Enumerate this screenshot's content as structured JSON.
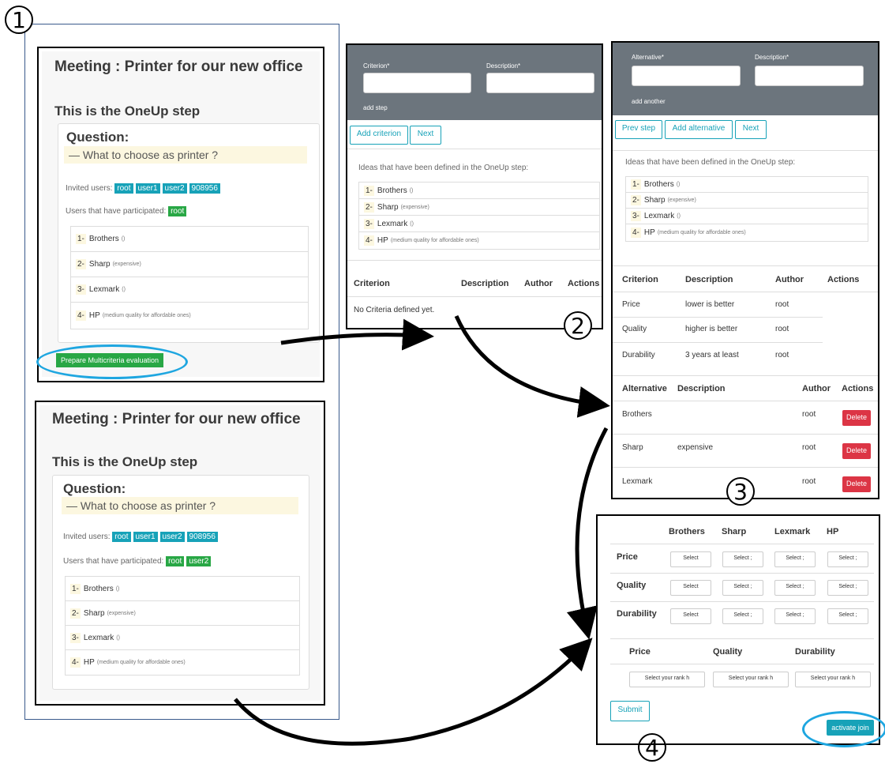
{
  "markers": [
    "1",
    "2",
    "3",
    "4"
  ],
  "panel1": {
    "meeting_title": "Meeting : Printer for our new office",
    "step_title": "This is the OneUp step",
    "question_label": "Question:",
    "question_text": "— What to choose as printer ?",
    "invited_label": "Invited users:",
    "invited_users": [
      "root",
      "user1",
      "user2",
      "908956"
    ],
    "participated_label": "Users that have participated:",
    "participated_users": [
      "root"
    ],
    "ideas": [
      {
        "num": "1-",
        "name": "Brothers",
        "note": "()"
      },
      {
        "num": "2-",
        "name": "Sharp",
        "note": "(expensive)"
      },
      {
        "num": "3-",
        "name": "Lexmark",
        "note": "()"
      },
      {
        "num": "4-",
        "name": "HP",
        "note": "(medium quality for affordable ones)"
      }
    ],
    "prepare_button": "Prepare Multicriteria evaluation"
  },
  "panel1b": {
    "meeting_title": "Meeting : Printer for our new office",
    "step_title": "This is the OneUp step",
    "question_label": "Question:",
    "question_text": "— What to choose as printer ?",
    "invited_label": "Invited users:",
    "invited_users": [
      "root",
      "user1",
      "user2",
      "908956"
    ],
    "participated_label": "Users that have participated:",
    "participated_users": [
      "root",
      "user2"
    ],
    "ideas": [
      {
        "num": "1-",
        "name": "Brothers",
        "note": "()"
      },
      {
        "num": "2-",
        "name": "Sharp",
        "note": "(expensive)"
      },
      {
        "num": "3-",
        "name": "Lexmark",
        "note": "()"
      },
      {
        "num": "4-",
        "name": "HP",
        "note": "(medium quality for affordable ones)"
      }
    ]
  },
  "panel2": {
    "criterion_label": "Criterion*",
    "description_label": "Description*",
    "add_step": "add step",
    "add_criterion_button": "Add criterion",
    "next_button": "Next",
    "ideas_heading": "Ideas that have been defined in the OneUp step:",
    "ideas": [
      {
        "num": "1-",
        "name": "Brothers",
        "note": "()"
      },
      {
        "num": "2-",
        "name": "Sharp",
        "note": "(expensive)"
      },
      {
        "num": "3-",
        "name": "Lexmark",
        "note": "()"
      },
      {
        "num": "4-",
        "name": "HP",
        "note": "(medium quality for affordable ones)"
      }
    ],
    "table_headers": [
      "Criterion",
      "Description",
      "Author",
      "Actions"
    ],
    "empty_text": "No Criteria defined yet."
  },
  "panel3": {
    "alternative_label": "Alternative*",
    "description_label": "Description*",
    "add_another": "add another",
    "prev_button": "Prev step",
    "add_alt_button": "Add alternative",
    "next_button": "Next",
    "ideas_heading": "Ideas that have been defined in the OneUp step:",
    "ideas": [
      {
        "num": "1-",
        "name": "Brothers",
        "note": "()"
      },
      {
        "num": "2-",
        "name": "Sharp",
        "note": "(expensive)"
      },
      {
        "num": "3-",
        "name": "Lexmark",
        "note": "()"
      },
      {
        "num": "4-",
        "name": "HP",
        "note": "(medium quality for affordable ones)"
      }
    ],
    "criteria_headers": [
      "Criterion",
      "Description",
      "Author",
      "Actions"
    ],
    "criteria": [
      {
        "name": "Price",
        "desc": "lower is better",
        "author": "root"
      },
      {
        "name": "Quality",
        "desc": "higher is better",
        "author": "root"
      },
      {
        "name": "Durability",
        "desc": "3 years at least",
        "author": "root"
      }
    ],
    "alt_headers": [
      "Alternative",
      "Description",
      "Author",
      "Actions"
    ],
    "alternatives": [
      {
        "name": "Brothers",
        "desc": "",
        "author": "root",
        "action": "Delete"
      },
      {
        "name": "Sharp",
        "desc": "expensive",
        "author": "root",
        "action": "Delete"
      },
      {
        "name": "Lexmark",
        "desc": "",
        "author": "root",
        "action": "Delete"
      }
    ]
  },
  "panel4": {
    "columns": [
      "Brothers",
      "Sharp",
      "Lexmark",
      "HP"
    ],
    "rows": [
      "Price",
      "Quality",
      "Durability"
    ],
    "select_labels": [
      "Select",
      "Select ;",
      "Select ;",
      "Select ;"
    ],
    "rank_headers": [
      "Price",
      "Quality",
      "Durability"
    ],
    "rank_select": "Select your rank h",
    "submit_button": "Submit",
    "activate_button": "activate join"
  },
  "colors": {
    "teal": "#17a2b8",
    "green": "#28a745",
    "red": "#dc3545",
    "header_gray": "#6c757d",
    "highlight_blue": "#1ea6e0"
  }
}
